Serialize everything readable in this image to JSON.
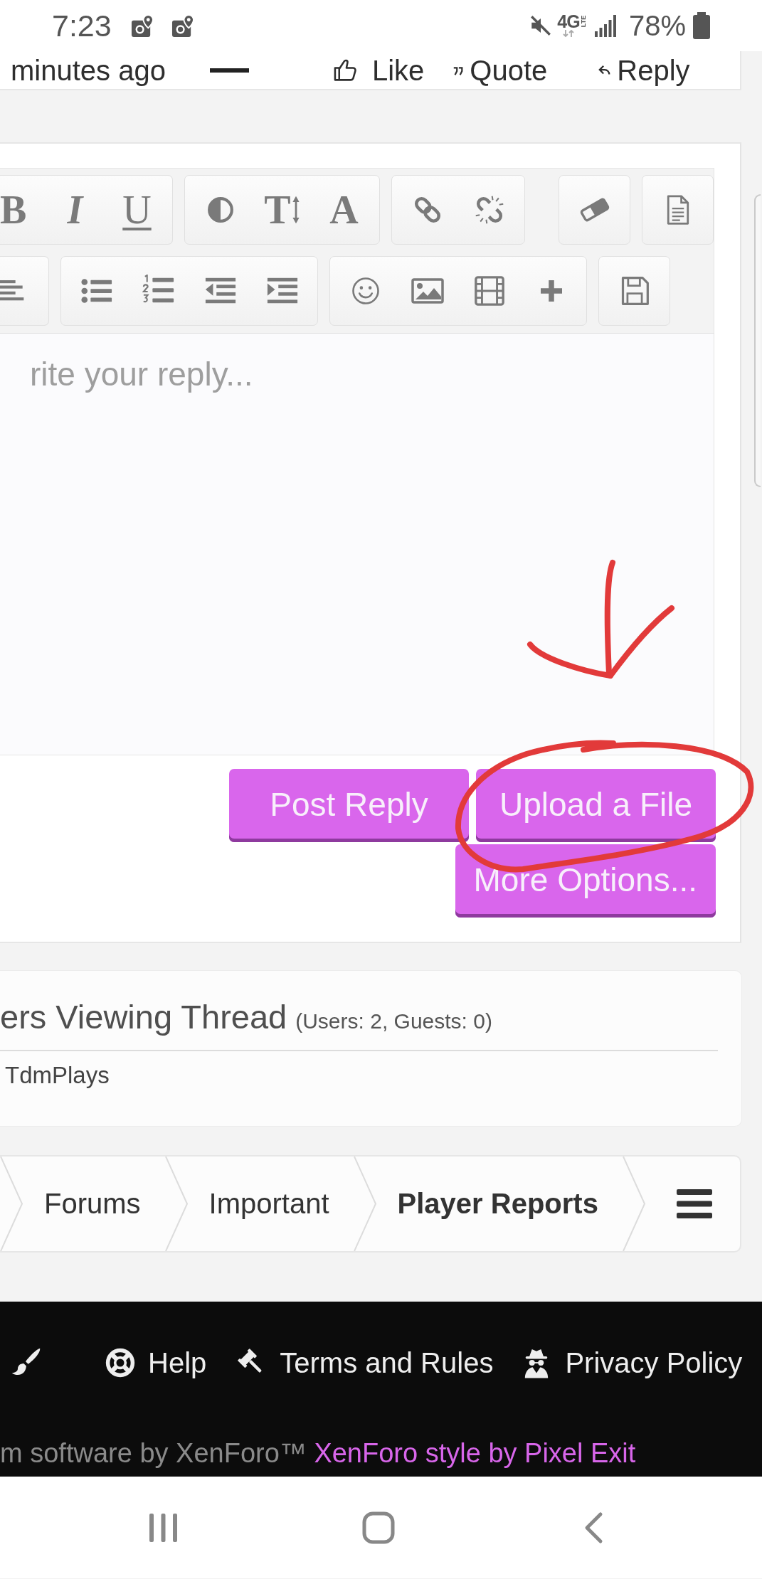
{
  "status_bar": {
    "time": "7:23",
    "network": "4G",
    "network_sub": "LTE",
    "battery": "78%"
  },
  "post_footer": {
    "time": "minutes ago",
    "actions": [
      {
        "kind": "like",
        "label": "Like"
      },
      {
        "kind": "quote",
        "label": "Quote"
      },
      {
        "kind": "reply",
        "label": "Reply"
      }
    ]
  },
  "editor": {
    "toolbar": {
      "rows": [
        {
          "groups": [
            {
              "buttons": [
                {
                  "kind": "bold",
                  "glyph": "B"
                },
                {
                  "kind": "italic",
                  "glyph": "I"
                },
                {
                  "kind": "underline",
                  "glyph": "U"
                }
              ]
            },
            {
              "buttons": [
                {
                  "kind": "contrast"
                },
                {
                  "kind": "font_size",
                  "glyph": "T"
                },
                {
                  "kind": "font_family",
                  "glyph": "A"
                }
              ]
            },
            {
              "buttons": [
                {
                  "kind": "link"
                },
                {
                  "kind": "unlink"
                }
              ]
            },
            {
              "buttons": [
                {
                  "kind": "eraser"
                }
              ]
            },
            {
              "buttons": [
                {
                  "kind": "document"
                }
              ]
            }
          ]
        },
        {
          "groups": [
            {
              "buttons": [
                {
                  "kind": "align_left"
                }
              ]
            },
            {
              "buttons": [
                {
                  "kind": "bullet_list"
                },
                {
                  "kind": "number_list"
                },
                {
                  "kind": "outdent"
                },
                {
                  "kind": "indent"
                }
              ]
            },
            {
              "buttons": [
                {
                  "kind": "smiley"
                },
                {
                  "kind": "image"
                },
                {
                  "kind": "video"
                },
                {
                  "kind": "insert"
                }
              ]
            },
            {
              "buttons": [
                {
                  "kind": "save"
                }
              ]
            }
          ]
        }
      ]
    },
    "placeholder": "rite your reply...",
    "buttons": [
      {
        "label": "Post Reply"
      },
      {
        "label": "Upload a File"
      },
      {
        "label": "More Options..."
      }
    ]
  },
  "viewers": {
    "title": "ers Viewing Thread",
    "counts": "(Users: 2, Guests: 0)",
    "users": [
      "TdmPlays"
    ]
  },
  "breadcrumb": {
    "items": [
      {
        "label": "Forums",
        "selected": false
      },
      {
        "label": "Important",
        "selected": false
      },
      {
        "label": "Player Reports",
        "selected": true
      }
    ]
  },
  "footer": {
    "links": [
      {
        "kind": "style"
      },
      {
        "kind": "help",
        "label": "Help"
      },
      {
        "kind": "terms",
        "label": "Terms and Rules"
      },
      {
        "kind": "privacy",
        "label": "Privacy Policy"
      }
    ],
    "credit": "m software by XenForo™",
    "credit_link": "XenForo style by Pixel Exit"
  }
}
